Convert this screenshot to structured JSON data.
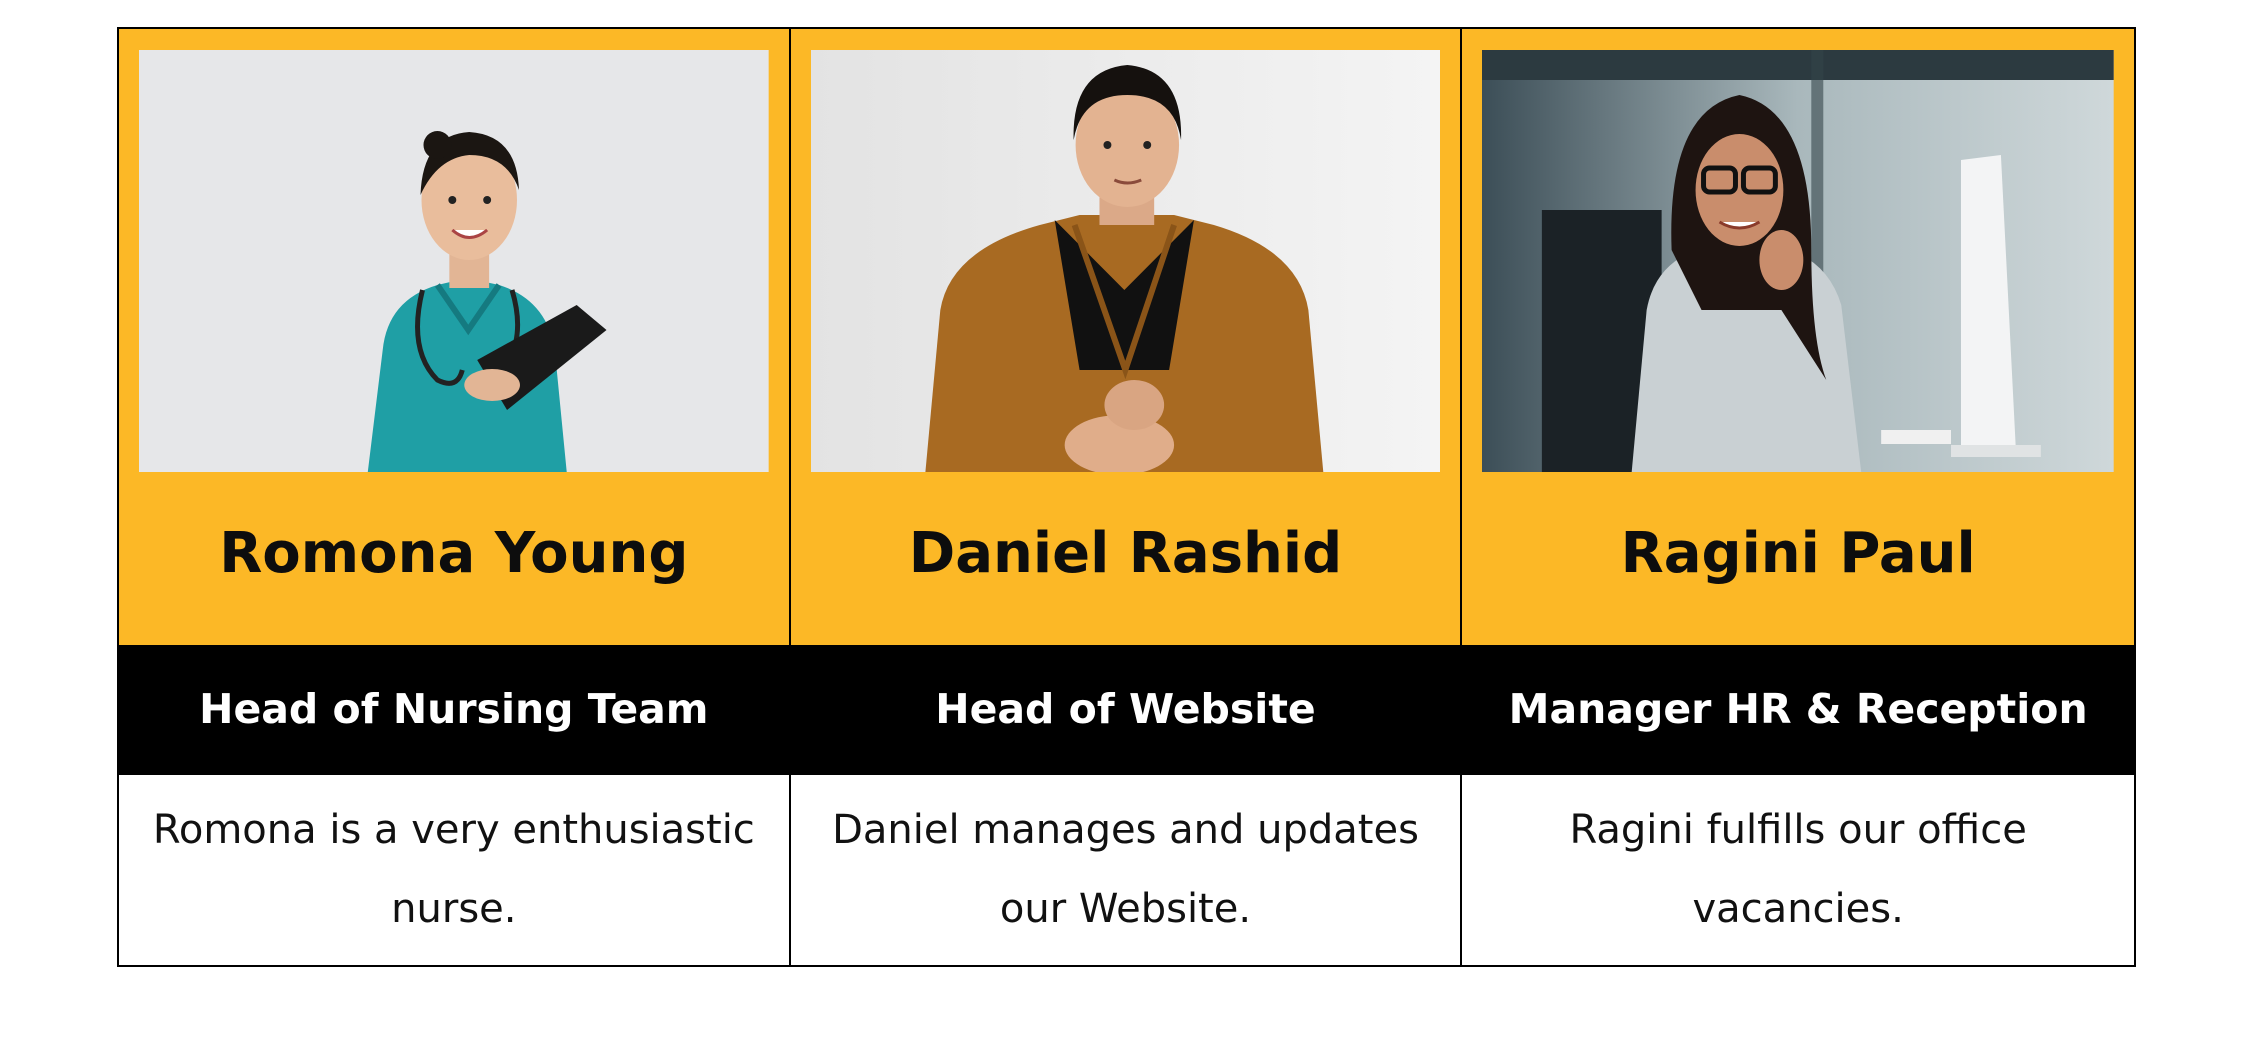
{
  "colors": {
    "accent": "#fcb826",
    "role_bar": "#000000",
    "text_dark": "#0d0d0d"
  },
  "members": [
    {
      "name": "Romona Young",
      "role": "Head of Nursing Team",
      "description": "Romona is a very enthusiastic nurse.",
      "photo_icon": "nurse-portrait"
    },
    {
      "name": "Daniel Rashid",
      "role": "Head of Website",
      "description": "Daniel manages and updates our Website.",
      "photo_icon": "man-portrait"
    },
    {
      "name": "Ragini Paul",
      "role": "Manager HR & Reception",
      "description": "Ragini fulfills our office vacancies.",
      "photo_icon": "woman-office-portrait"
    }
  ]
}
